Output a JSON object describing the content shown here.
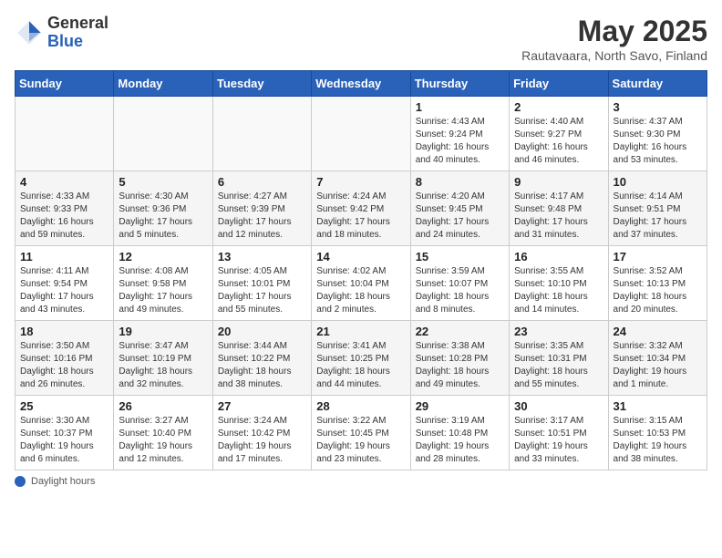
{
  "header": {
    "logo_general": "General",
    "logo_blue": "Blue",
    "month_title": "May 2025",
    "subtitle": "Rautavaara, North Savo, Finland"
  },
  "weekdays": [
    "Sunday",
    "Monday",
    "Tuesday",
    "Wednesday",
    "Thursday",
    "Friday",
    "Saturday"
  ],
  "weeks": [
    [
      {
        "day": "",
        "info": ""
      },
      {
        "day": "",
        "info": ""
      },
      {
        "day": "",
        "info": ""
      },
      {
        "day": "",
        "info": ""
      },
      {
        "day": "1",
        "info": "Sunrise: 4:43 AM\nSunset: 9:24 PM\nDaylight: 16 hours\nand 40 minutes."
      },
      {
        "day": "2",
        "info": "Sunrise: 4:40 AM\nSunset: 9:27 PM\nDaylight: 16 hours\nand 46 minutes."
      },
      {
        "day": "3",
        "info": "Sunrise: 4:37 AM\nSunset: 9:30 PM\nDaylight: 16 hours\nand 53 minutes."
      }
    ],
    [
      {
        "day": "4",
        "info": "Sunrise: 4:33 AM\nSunset: 9:33 PM\nDaylight: 16 hours\nand 59 minutes."
      },
      {
        "day": "5",
        "info": "Sunrise: 4:30 AM\nSunset: 9:36 PM\nDaylight: 17 hours\nand 5 minutes."
      },
      {
        "day": "6",
        "info": "Sunrise: 4:27 AM\nSunset: 9:39 PM\nDaylight: 17 hours\nand 12 minutes."
      },
      {
        "day": "7",
        "info": "Sunrise: 4:24 AM\nSunset: 9:42 PM\nDaylight: 17 hours\nand 18 minutes."
      },
      {
        "day": "8",
        "info": "Sunrise: 4:20 AM\nSunset: 9:45 PM\nDaylight: 17 hours\nand 24 minutes."
      },
      {
        "day": "9",
        "info": "Sunrise: 4:17 AM\nSunset: 9:48 PM\nDaylight: 17 hours\nand 31 minutes."
      },
      {
        "day": "10",
        "info": "Sunrise: 4:14 AM\nSunset: 9:51 PM\nDaylight: 17 hours\nand 37 minutes."
      }
    ],
    [
      {
        "day": "11",
        "info": "Sunrise: 4:11 AM\nSunset: 9:54 PM\nDaylight: 17 hours\nand 43 minutes."
      },
      {
        "day": "12",
        "info": "Sunrise: 4:08 AM\nSunset: 9:58 PM\nDaylight: 17 hours\nand 49 minutes."
      },
      {
        "day": "13",
        "info": "Sunrise: 4:05 AM\nSunset: 10:01 PM\nDaylight: 17 hours\nand 55 minutes."
      },
      {
        "day": "14",
        "info": "Sunrise: 4:02 AM\nSunset: 10:04 PM\nDaylight: 18 hours\nand 2 minutes."
      },
      {
        "day": "15",
        "info": "Sunrise: 3:59 AM\nSunset: 10:07 PM\nDaylight: 18 hours\nand 8 minutes."
      },
      {
        "day": "16",
        "info": "Sunrise: 3:55 AM\nSunset: 10:10 PM\nDaylight: 18 hours\nand 14 minutes."
      },
      {
        "day": "17",
        "info": "Sunrise: 3:52 AM\nSunset: 10:13 PM\nDaylight: 18 hours\nand 20 minutes."
      }
    ],
    [
      {
        "day": "18",
        "info": "Sunrise: 3:50 AM\nSunset: 10:16 PM\nDaylight: 18 hours\nand 26 minutes."
      },
      {
        "day": "19",
        "info": "Sunrise: 3:47 AM\nSunset: 10:19 PM\nDaylight: 18 hours\nand 32 minutes."
      },
      {
        "day": "20",
        "info": "Sunrise: 3:44 AM\nSunset: 10:22 PM\nDaylight: 18 hours\nand 38 minutes."
      },
      {
        "day": "21",
        "info": "Sunrise: 3:41 AM\nSunset: 10:25 PM\nDaylight: 18 hours\nand 44 minutes."
      },
      {
        "day": "22",
        "info": "Sunrise: 3:38 AM\nSunset: 10:28 PM\nDaylight: 18 hours\nand 49 minutes."
      },
      {
        "day": "23",
        "info": "Sunrise: 3:35 AM\nSunset: 10:31 PM\nDaylight: 18 hours\nand 55 minutes."
      },
      {
        "day": "24",
        "info": "Sunrise: 3:32 AM\nSunset: 10:34 PM\nDaylight: 19 hours\nand 1 minute."
      }
    ],
    [
      {
        "day": "25",
        "info": "Sunrise: 3:30 AM\nSunset: 10:37 PM\nDaylight: 19 hours\nand 6 minutes."
      },
      {
        "day": "26",
        "info": "Sunrise: 3:27 AM\nSunset: 10:40 PM\nDaylight: 19 hours\nand 12 minutes."
      },
      {
        "day": "27",
        "info": "Sunrise: 3:24 AM\nSunset: 10:42 PM\nDaylight: 19 hours\nand 17 minutes."
      },
      {
        "day": "28",
        "info": "Sunrise: 3:22 AM\nSunset: 10:45 PM\nDaylight: 19 hours\nand 23 minutes."
      },
      {
        "day": "29",
        "info": "Sunrise: 3:19 AM\nSunset: 10:48 PM\nDaylight: 19 hours\nand 28 minutes."
      },
      {
        "day": "30",
        "info": "Sunrise: 3:17 AM\nSunset: 10:51 PM\nDaylight: 19 hours\nand 33 minutes."
      },
      {
        "day": "31",
        "info": "Sunrise: 3:15 AM\nSunset: 10:53 PM\nDaylight: 19 hours\nand 38 minutes."
      }
    ]
  ],
  "footer": {
    "label": "Daylight hours"
  }
}
